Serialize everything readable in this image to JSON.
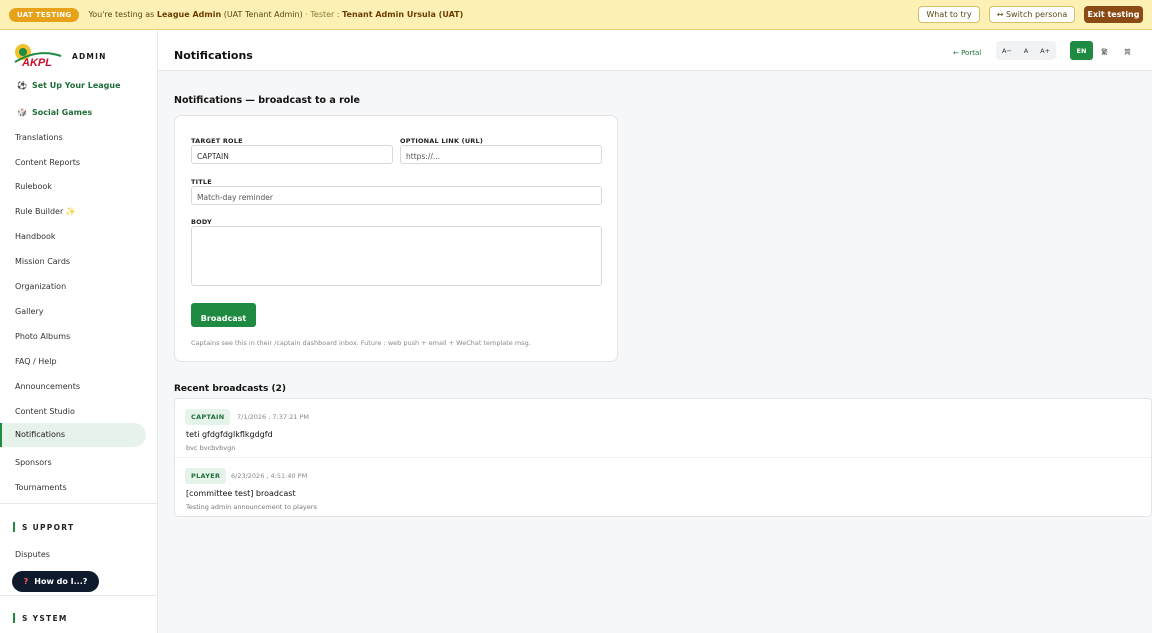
{
  "banner": {
    "pill": "UAT TESTING",
    "prefix": "You're testing as",
    "role": "League Admin",
    "role_detail": "(UAT Tenant Admin)",
    "tester_label": "· Tester :",
    "tester_name": "Tenant Admin Ursula (UAT)",
    "what_to_try": "What to try",
    "switch_persona": "↔ Switch persona",
    "exit_testing": "Exit testing"
  },
  "brand": {
    "logo_text": "AKPL",
    "label": "ADMIN"
  },
  "sidebar": {
    "top_items": [
      {
        "emoji": "⚽",
        "label": "Set Up Your League"
      },
      {
        "emoji": "🎲",
        "label": "Social Games"
      }
    ],
    "items": [
      "Translations",
      "Content Reports",
      "Rulebook",
      "Rule Builder",
      "Handbook",
      "Mission Cards",
      "Organization",
      "Gallery",
      "Photo Albums",
      "FAQ / Help",
      "Announcements",
      "Content Studio",
      "Notifications",
      "Sponsors",
      "Tournaments"
    ],
    "rule_builder_emoji": "✨",
    "support_section": "S UPPORT",
    "support_items": [
      "Disputes"
    ],
    "system_section": "S YSTEM",
    "help_button": "How do I...?",
    "help_icon": "?"
  },
  "header": {
    "title": "Notifications",
    "portal_link": "← Portal",
    "font_sizes": [
      "A−",
      "A",
      "A+"
    ],
    "languages": [
      "EN",
      "繁",
      "简"
    ],
    "active_language": "EN"
  },
  "form": {
    "section_title": "Notifications — broadcast to a role",
    "target_role_label": "TARGET ROLE",
    "target_role_value": "CAPTAIN",
    "link_label": "OPTIONAL LINK (URL)",
    "link_placeholder": "https://...",
    "title_label": "TITLE",
    "title_placeholder": "Match-day reminder",
    "body_label": "BODY",
    "submit_label": "Broadcast",
    "hint": "Captains see this in their /captain dashboard inbox. Future : web push + email + WeChat template msg."
  },
  "recent": {
    "title": "Recent broadcasts (2)",
    "items": [
      {
        "role": "CAPTAIN",
        "timestamp": "7/1/2026 , 7:37:21 PM",
        "title": "teti gfdgfdglkflkgdgfd",
        "body": "bvc bvcbvbvgn"
      },
      {
        "role": "PLAYER",
        "timestamp": "6/23/2026 , 4:51:40 PM",
        "title": "[committee test] broadcast",
        "body": "Testing admin announcement to players"
      }
    ]
  },
  "colors": {
    "accent": "#1f8a42",
    "banner_bg": "#fdf0b4",
    "exit_button": "#8a4a14",
    "help_button": "#0f1b2d"
  }
}
